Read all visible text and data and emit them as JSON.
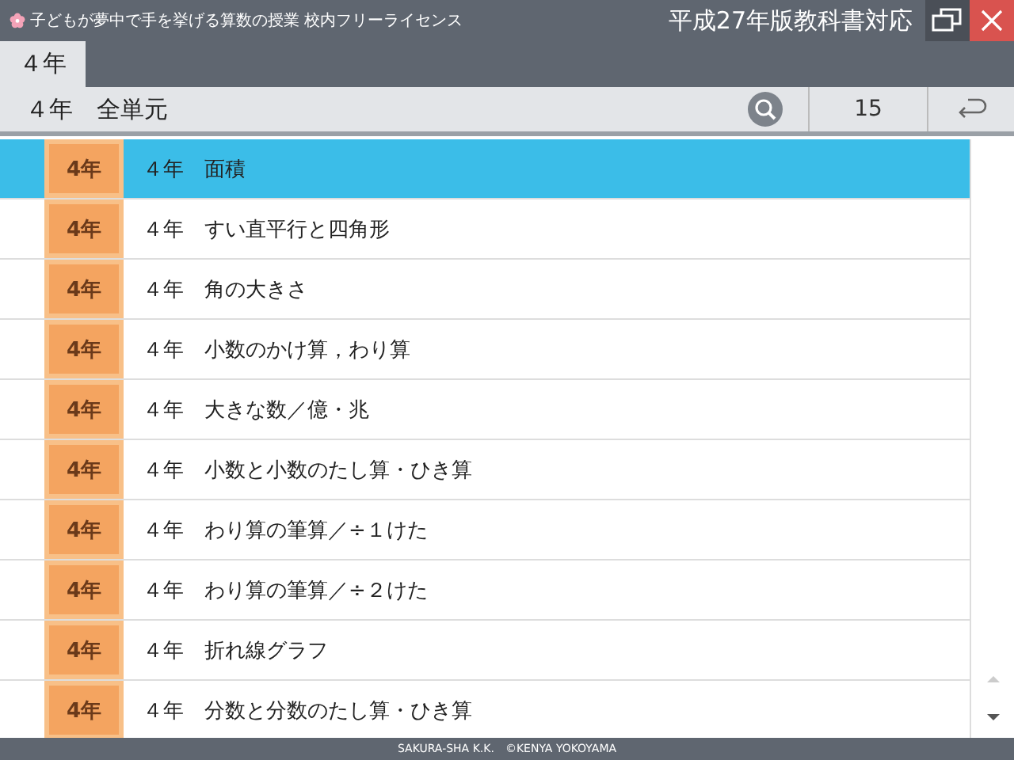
{
  "window": {
    "title": "子どもが夢中で手を挙げる算数の授業 校内フリーライセンス",
    "edition": "平成27年版教科書対応"
  },
  "tabs": [
    {
      "label": "４年",
      "selected": true
    }
  ],
  "header": {
    "title": "４年　全単元",
    "count": "15"
  },
  "units": [
    {
      "badge": "4年",
      "title": "４年　面積",
      "selected": true
    },
    {
      "badge": "4年",
      "title": "４年　すい直平行と四角形",
      "selected": false
    },
    {
      "badge": "4年",
      "title": "４年　角の大きさ",
      "selected": false
    },
    {
      "badge": "4年",
      "title": "４年　小数のかけ算，わり算",
      "selected": false
    },
    {
      "badge": "4年",
      "title": "４年　大きな数／億・兆",
      "selected": false
    },
    {
      "badge": "4年",
      "title": "４年　小数と小数のたし算・ひき算",
      "selected": false
    },
    {
      "badge": "4年",
      "title": "４年　わり算の筆算／÷１けた",
      "selected": false
    },
    {
      "badge": "4年",
      "title": "４年　わり算の筆算／÷２けた",
      "selected": false
    },
    {
      "badge": "4年",
      "title": "４年　折れ線グラフ",
      "selected": false
    },
    {
      "badge": "4年",
      "title": "４年　分数と分数のたし算・ひき算",
      "selected": false
    }
  ],
  "footer": "SAKURA-SHA K.K.　©KENYA YOKOYAMA"
}
